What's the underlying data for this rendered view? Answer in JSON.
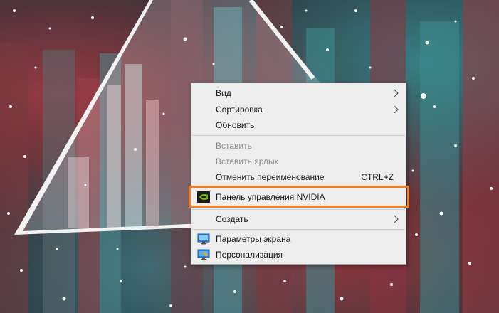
{
  "context_menu": {
    "items": [
      {
        "label": "Вид",
        "submenu": true,
        "enabled": true
      },
      {
        "label": "Сортировка",
        "submenu": true,
        "enabled": true
      },
      {
        "label": "Обновить",
        "enabled": true
      },
      {
        "label": "Вставить",
        "enabled": false
      },
      {
        "label": "Вставить ярлык",
        "enabled": false
      },
      {
        "label": "Отменить переименование",
        "shortcut": "CTRL+Z",
        "enabled": true
      },
      {
        "label": "Панель управления NVIDIA",
        "icon": "nvidia-icon",
        "enabled": true,
        "highlighted": true
      },
      {
        "label": "Создать",
        "submenu": true,
        "enabled": true
      },
      {
        "label": "Параметры экрана",
        "icon": "display-settings-icon",
        "enabled": true
      },
      {
        "label": "Персонализация",
        "icon": "personalization-icon",
        "enabled": true
      }
    ]
  },
  "colors": {
    "highlight_border": "#ef7d22",
    "menu_background": "#eeeeee",
    "disabled_text": "#8d8d8d",
    "nvidia_green": "#76b900"
  }
}
